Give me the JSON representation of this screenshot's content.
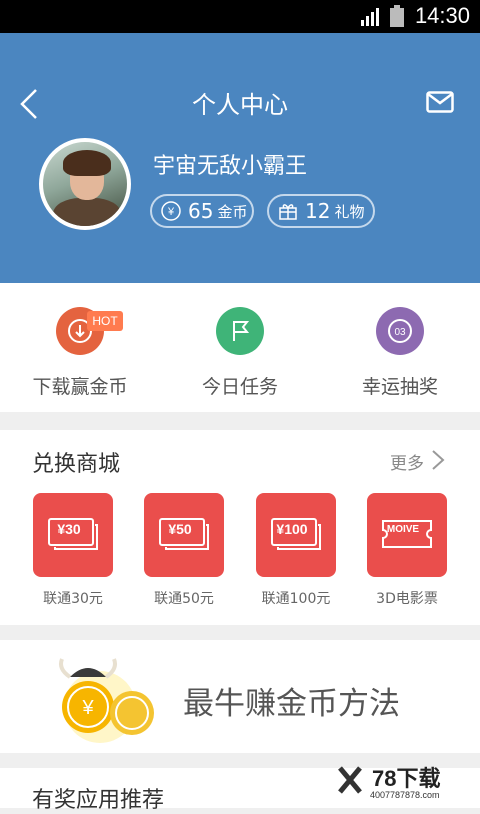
{
  "status_bar": {
    "time": "14:30"
  },
  "header": {
    "title": "个人中心",
    "username": "宇宙无敌小霸王",
    "coins": {
      "value": "65",
      "unit": "金币"
    },
    "gifts": {
      "value": "12",
      "unit": "礼物"
    }
  },
  "quick_actions": [
    {
      "label": "下载赢金币",
      "badge": "HOT",
      "color": "#e4633f"
    },
    {
      "label": "今日任务",
      "color": "#3fb478"
    },
    {
      "label": "幸运抽奖",
      "color": "#8d6ab1"
    }
  ],
  "shop": {
    "title": "兑换商城",
    "more": "更多",
    "items": [
      {
        "card_text": "¥30",
        "label": "联通30元"
      },
      {
        "card_text": "¥50",
        "label": "联通50元"
      },
      {
        "card_text": "¥100",
        "label": "联通100元"
      },
      {
        "card_text": "MOIVE",
        "label": "3D电影票"
      }
    ]
  },
  "banner": {
    "text": "最牛赚金币方法"
  },
  "recommend": {
    "title": "有奖应用推荐"
  },
  "watermark": {
    "brand": "78下载",
    "phone": "4007787878.com"
  }
}
